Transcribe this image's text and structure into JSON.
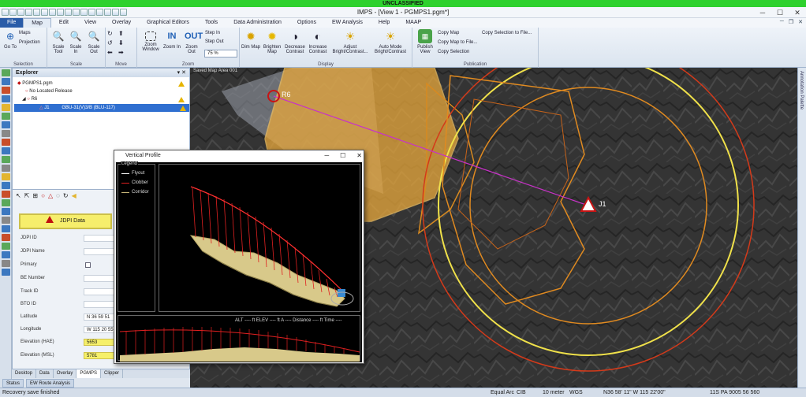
{
  "classification": "UNCLASSIFIED",
  "window": {
    "title": "IMPS - [View 1 - PGMPS1.pgm*]"
  },
  "menu": {
    "tabs": [
      "File",
      "Map",
      "Edit",
      "View",
      "Overlay",
      "Graphical Editors",
      "Tools",
      "Data Administration",
      "Options",
      "EW Analysis",
      "Help",
      "MAAP"
    ],
    "active": "Map"
  },
  "ribbon": {
    "selection": {
      "caption": "Selection",
      "go_to": "Go To",
      "maps": "Maps",
      "projection": "Projection"
    },
    "scale": {
      "caption": "Scale",
      "scale_tool": "Scale Tool",
      "scale_in": "Scale In",
      "scale_out": "Scale Out"
    },
    "move": {
      "caption": "Move"
    },
    "zoom": {
      "caption": "Zoom",
      "zoom_window": "Zoom Window",
      "zoom_in": "Zoom In",
      "zoom_out": "Zoom Out",
      "in_label": "IN",
      "out_label": "OUT",
      "step_in": "Step In",
      "step_out": "Step Out",
      "zoom_value": "75 %"
    },
    "display": {
      "caption": "Display",
      "dim_map": "Dim Map",
      "brighten_map": "Brighten Map",
      "decrease_contrast": "Decrease Contrast",
      "increase_contrast": "Increase Contrast",
      "adjust": "Adjust Bright/Contrast...",
      "auto_mode": "Auto Mode Bright/Contrast"
    },
    "publication": {
      "caption": "Publication",
      "publish_view": "Publish View",
      "copy_map": "Copy Map",
      "copy_map_to_file": "Copy Map to File...",
      "copy_selection": "Copy Selection",
      "copy_selection_to_file": "Copy Selection to File..."
    }
  },
  "explorer": {
    "title": "Explorer",
    "pin": "▾ ✕",
    "items": [
      {
        "label": "PGMPS1.pgm"
      },
      {
        "label": "No Located Release"
      },
      {
        "label": "R6"
      },
      {
        "label": "J1",
        "detail": "GBU-31(V)3/B (BLU-117)"
      }
    ]
  },
  "jdpi": {
    "button": "JDPI Data",
    "fields": [
      {
        "label": "JDPI ID",
        "value": ""
      },
      {
        "label": "JDPI Name",
        "value": ""
      },
      {
        "label": "Primary",
        "value": ""
      },
      {
        "label": "BE Number",
        "value": ""
      },
      {
        "label": "Track ID",
        "value": ""
      },
      {
        "label": "BTO ID",
        "value": ""
      },
      {
        "label": "Latitude",
        "value": "N 36 59 51"
      },
      {
        "label": "Longitude",
        "value": "W 115 20 55"
      },
      {
        "label": "Elevation (HAE)",
        "value": "5653"
      },
      {
        "label": "Elevation (MSL)",
        "value": "5781"
      }
    ]
  },
  "bottom_tabs": [
    "Desktop",
    "Data",
    "Overlay",
    "PGMPS",
    "Clipper"
  ],
  "bottom_tabs_active": "PGMPS",
  "bottom_tabs2": [
    "Status",
    "EW Route Analysis"
  ],
  "map": {
    "title": "Saved Map Area 001",
    "marker_r6": "R6",
    "marker_j1": "J1",
    "right_strip": "Annotation Palette"
  },
  "vertical_profile": {
    "title": "Vertical Profile",
    "legend_title": "Legend",
    "legend": [
      {
        "label": "Flyout",
        "color": "#ffffff"
      },
      {
        "label": "Clobber",
        "color": "#e02020"
      },
      {
        "label": "Corridor",
        "color": "#c9b87a"
      }
    ],
    "readout": "ALT ---- ft  ELEV ---- ft  A ---- Distance ---- ft  Time ----"
  },
  "status": {
    "message": "Recovery save finished",
    "datum_label": "Equal Arc",
    "cib": "CIB",
    "scale": "10 meter",
    "wgs": "WGS",
    "coords": "N36 58' 11\" W 115 22'00\"",
    "mgrs": "11S PA 9005 56 560"
  }
}
